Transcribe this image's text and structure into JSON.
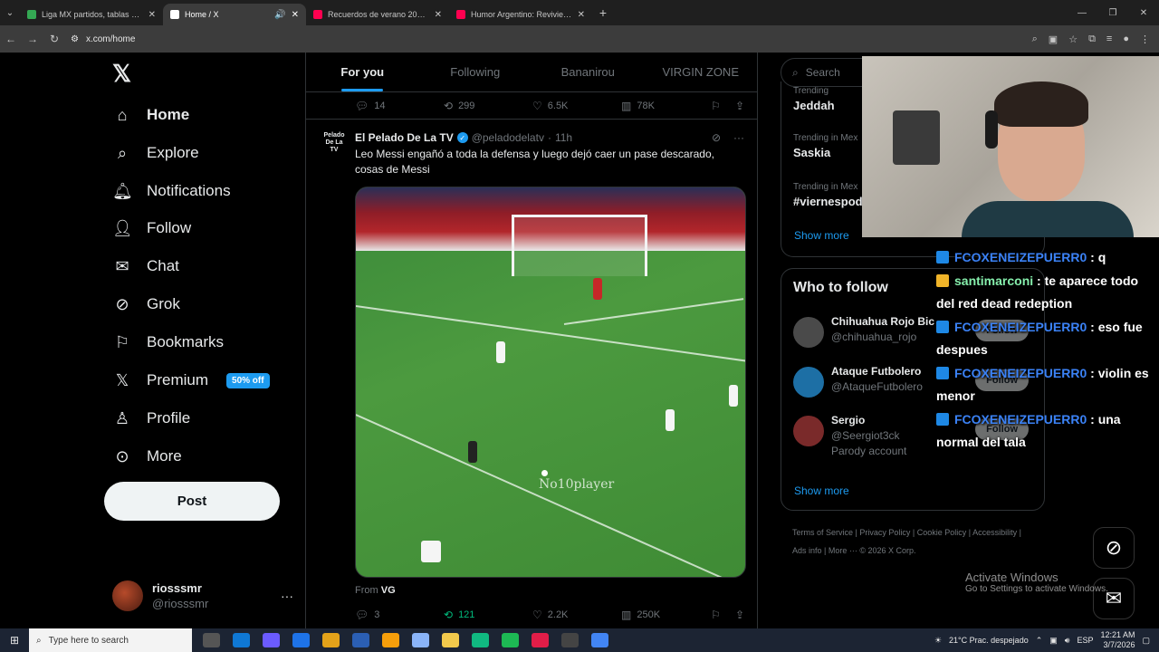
{
  "browser": {
    "tabs": [
      {
        "label": "Liga MX partidos, tablas y notic",
        "icon_color": "#34a853",
        "active": false
      },
      {
        "label": "Home / X",
        "icon_color": "#ffffff",
        "active": true
      },
      {
        "label": "Recuerdos de verano 2024 para",
        "icon_color": "#ff0050",
        "active": false
      },
      {
        "label": "Humor Argentino: Reviviendo l",
        "icon_color": "#ff0050",
        "active": false
      }
    ],
    "url": "x.com/home"
  },
  "sidebar": {
    "items": [
      {
        "label": "Home",
        "icon": "home-icon"
      },
      {
        "label": "Explore",
        "icon": "search-icon"
      },
      {
        "label": "Notifications",
        "icon": "bell-icon"
      },
      {
        "label": "Follow",
        "icon": "add-person-icon"
      },
      {
        "label": "Chat",
        "icon": "mail-icon"
      },
      {
        "label": "Grok",
        "icon": "grok-icon"
      },
      {
        "label": "Bookmarks",
        "icon": "bookmark-icon"
      },
      {
        "label": "Premium",
        "icon": "x-logo-icon"
      },
      {
        "label": "Profile",
        "icon": "person-icon"
      },
      {
        "label": "More",
        "icon": "more-circle-icon"
      }
    ],
    "premium_badge": "50% off",
    "post_label": "Post",
    "account": {
      "name": "riosssmr",
      "handle": "@riosssmr"
    }
  },
  "feed": {
    "tabs": [
      "For you",
      "Following",
      "Bananirou",
      "VIRGIN ZONE"
    ],
    "prev_tweet_stats": {
      "replies": "14",
      "reposts": "299",
      "likes": "6.5K",
      "views": "78K"
    },
    "tweet": {
      "author": "El Pelado De La TV",
      "handle": "@peladodelatv",
      "time": "11h",
      "avatar_text": "Pelado De La TV",
      "text": "Leo Messi engañó a toda la defensa y luego dejó caer un pase descarado, cosas de Messi",
      "media_watermark": "No10player",
      "from_label": "From",
      "from_source": "VG",
      "stats": {
        "replies": "3",
        "reposts": "121",
        "likes": "2.2K",
        "views": "250K"
      }
    }
  },
  "right": {
    "search_placeholder": "Search",
    "trends": [
      {
        "context": "Trending",
        "name": "Jeddah"
      },
      {
        "context": "Trending in Mex",
        "name": "Saskia"
      },
      {
        "context": "Trending in Mex",
        "name": "#viernespod"
      }
    ],
    "show_more": "Show more",
    "who_to_follow_title": "Who to follow",
    "suggestions": [
      {
        "name": "Chihuahua Rojo Bic",
        "handle": "@chihuahua_rojo",
        "extra": "",
        "avatar_color": "#4a4a4a"
      },
      {
        "name": "Ataque Futbolero",
        "handle": "@AtaqueFutbolero",
        "extra": "",
        "avatar_color": "#1d6fa5"
      },
      {
        "name": "Sergio",
        "handle": "@Seergiot3ck",
        "extra": "Parody account",
        "avatar_color": "#7a2a2a"
      }
    ],
    "follow_label": "Follow",
    "footer": "Terms of Service | Privacy Policy | Cookie Policy | Accessibility | Ads info | More ··· © 2026 X Corp."
  },
  "stream_chat": [
    {
      "user": "FCOXENEIZEPUERR0",
      "text": ": q",
      "style": "blue"
    },
    {
      "user": "santimarconi",
      "text": ": te aparece todo del red dead redeption",
      "style": "green"
    },
    {
      "user": "FCOXENEIZEPUERR0",
      "text": ": eso fue despues",
      "style": "blue"
    },
    {
      "user": "FCOXENEIZEPUERR0",
      "text": ": violin es menor",
      "style": "blue"
    },
    {
      "user": "FCOXENEIZEPUERR0",
      "text": ": una normal del tala",
      "style": "blue"
    }
  ],
  "watermark": {
    "title": "Activate Windows",
    "subtitle": "Go to Settings to activate Windows."
  },
  "taskbar": {
    "search_placeholder": "Type here to search",
    "weather": "21°C  Prac. despejado",
    "lang": "ESP",
    "time": "12:21 AM",
    "date": "3/7/2026"
  }
}
